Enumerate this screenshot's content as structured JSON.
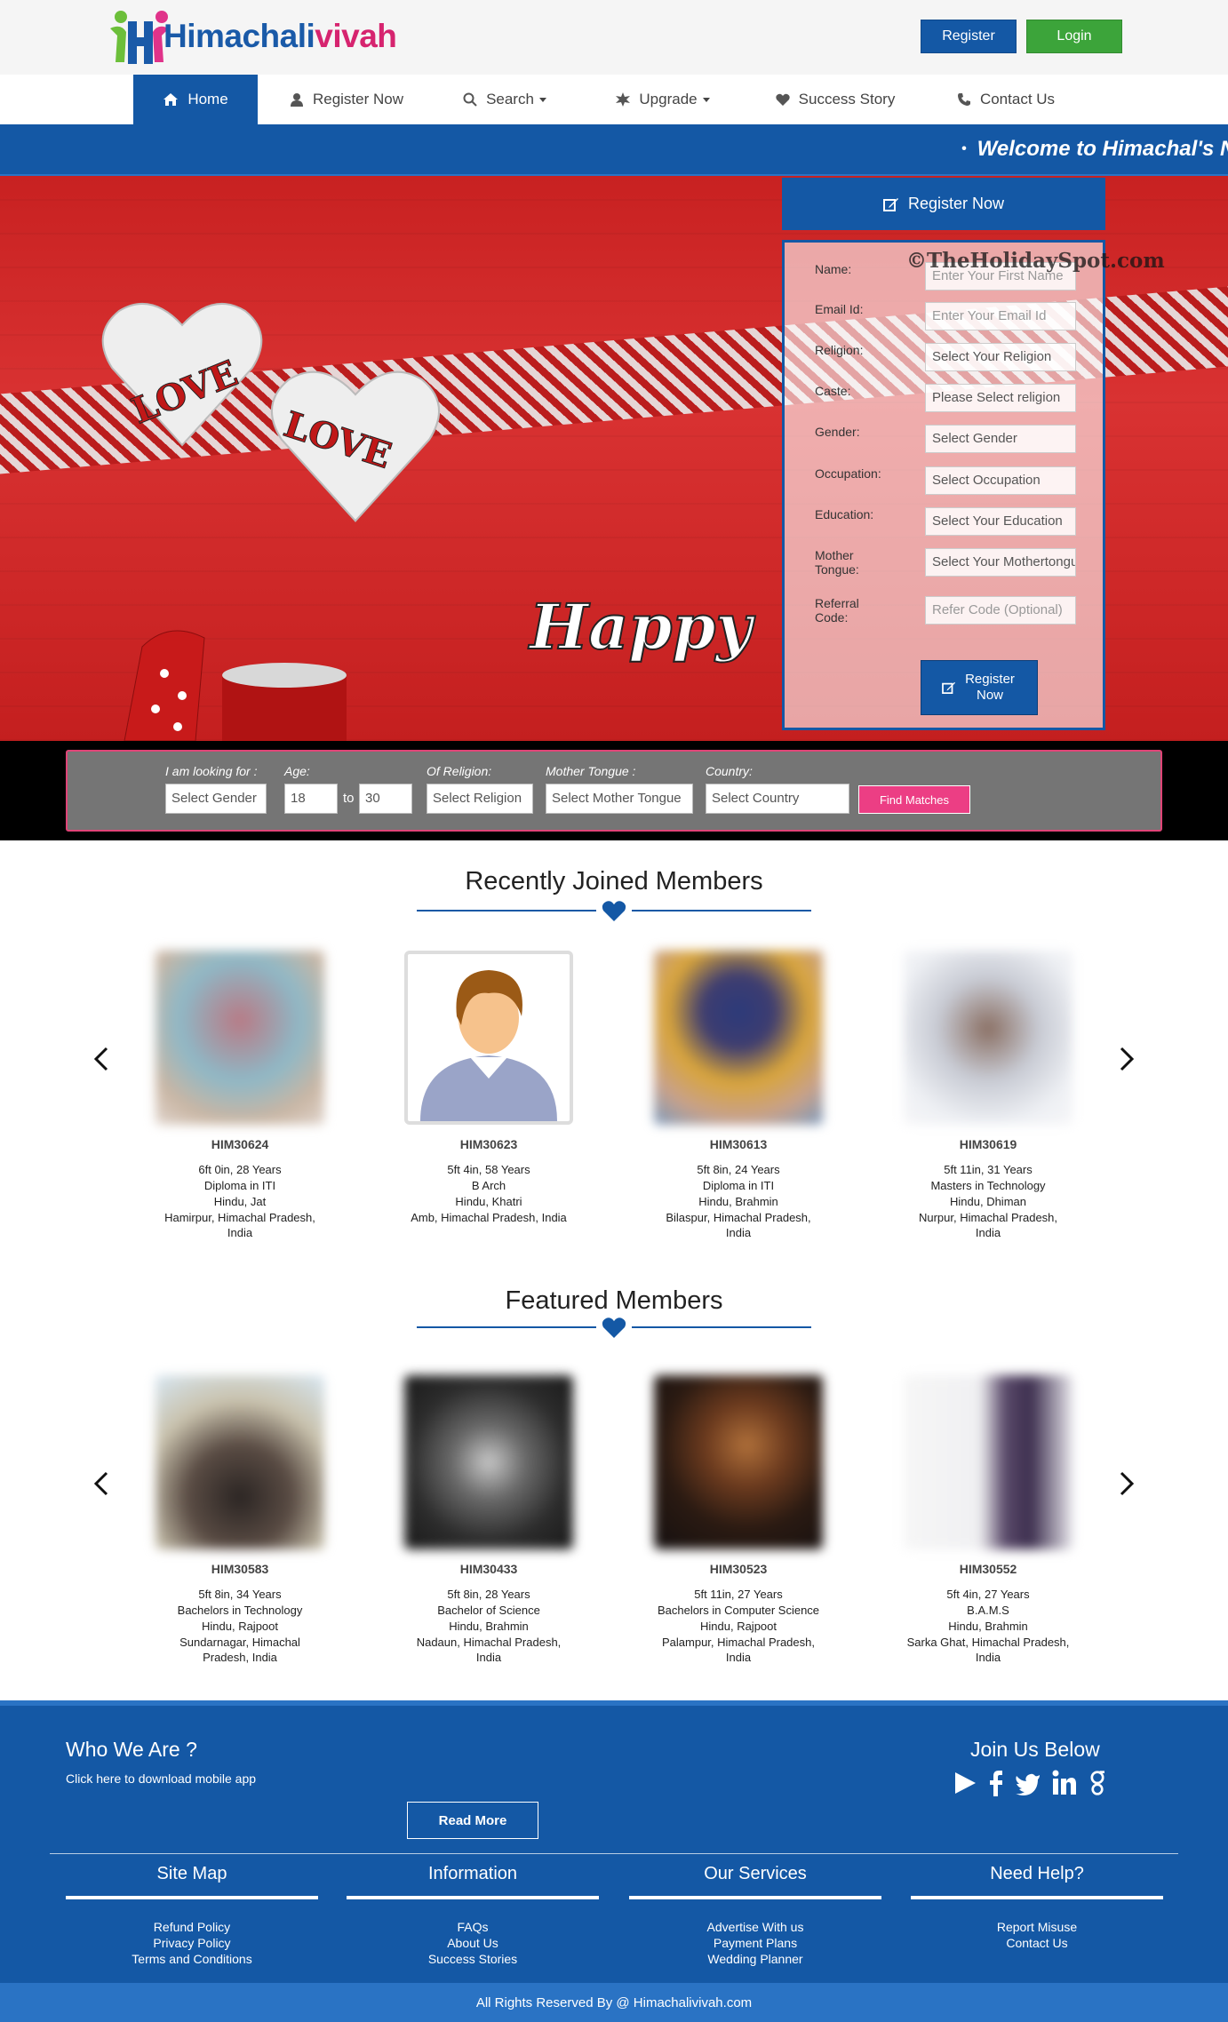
{
  "brand": {
    "part1": "Himachali",
    "part2": "vivah",
    "logo_letter": "H"
  },
  "header": {
    "register_label": "Register",
    "login_label": "Login"
  },
  "nav": {
    "items": [
      {
        "label": "Home",
        "icon": "home-icon"
      },
      {
        "label": "Register Now",
        "icon": "user-icon"
      },
      {
        "label": "Search",
        "icon": "search-icon"
      },
      {
        "label": "Upgrade",
        "icon": "badge-icon"
      },
      {
        "label": "Success Story",
        "icon": "heart-icon"
      },
      {
        "label": "Contact Us",
        "icon": "phone-icon"
      }
    ]
  },
  "marquee": {
    "text": "Welcome to Himachal's N"
  },
  "hero": {
    "heart1": "LOVE",
    "heart2": "LOVE",
    "script": "Happy",
    "watermark": "©TheHolidaySpot.com"
  },
  "register_form": {
    "title": "Register Now",
    "fields": [
      {
        "label": "Name:",
        "value": "Enter Your First Name",
        "placeholder": true
      },
      {
        "label": "Email Id:",
        "value": "Enter Your Email Id",
        "placeholder": true
      },
      {
        "label": "Religion:",
        "value": "Select Your Religion",
        "placeholder": false
      },
      {
        "label": "Caste:",
        "value": "Please Select religion",
        "placeholder": false
      },
      {
        "label": "Gender:",
        "value": "Select Gender",
        "placeholder": false
      },
      {
        "label": "Occupation:",
        "value": "Select Occupation",
        "placeholder": false
      },
      {
        "label": "Education:",
        "value": "Select Your Education",
        "placeholder": false
      },
      {
        "label": "Mother Tongue:",
        "value": "Select Your Mothertongue",
        "placeholder": false
      },
      {
        "label": "Referral Code:",
        "value": "Refer Code (Optional)",
        "placeholder": true
      }
    ],
    "submit_label": "Register Now"
  },
  "quick_search": {
    "looking_label": "I am looking for :",
    "gender_value": "Select Gender",
    "age_label": "Age:",
    "age_from": "18",
    "age_to_label": "to",
    "age_to": "30",
    "religion_label": "Of Religion:",
    "religion_value": "Select Religion",
    "tongue_label": "Mother Tongue :",
    "tongue_value": "Select Mother Tongue",
    "country_label": "Country:",
    "country_value": "Select Country",
    "find_label": "Find Matches"
  },
  "recent": {
    "title": "Recently Joined Members",
    "members": [
      {
        "id": "HIM30624",
        "l1": "6ft 0in, 28 Years",
        "l2": "Diploma in ITI",
        "l3": "Hindu, Jat",
        "l4": "Hamirpur, Himachal Pradesh,",
        "l5": "India",
        "photo": "blurred"
      },
      {
        "id": "HIM30623",
        "l1": "5ft 4in, 58 Years",
        "l2": "B Arch",
        "l3": "Hindu, Khatri",
        "l4": "Amb, Himachal Pradesh, India",
        "l5": "",
        "photo": "avatar"
      },
      {
        "id": "HIM30613",
        "l1": "5ft 8in, 24 Years",
        "l2": "Diploma in ITI",
        "l3": "Hindu, Brahmin",
        "l4": "Bilaspur, Himachal Pradesh,",
        "l5": "India",
        "photo": "blurred"
      },
      {
        "id": "HIM30619",
        "l1": "5ft 11in, 31 Years",
        "l2": "Masters in Technology",
        "l3": "Hindu, Dhiman",
        "l4": "Nurpur, Himachal Pradesh,",
        "l5": "India",
        "photo": "blurred"
      }
    ]
  },
  "featured": {
    "title": "Featured Members",
    "members": [
      {
        "id": "HIM30583",
        "l1": "5ft 8in, 34 Years",
        "l2": "Bachelors in Technology",
        "l3": "Hindu, Rajpoot",
        "l4": "Sundarnagar, Himachal",
        "l5": "Pradesh, India"
      },
      {
        "id": "HIM30433",
        "l1": "5ft 8in, 28 Years",
        "l2": "Bachelor of Science",
        "l3": "Hindu, Brahmin",
        "l4": "Nadaun, Himachal Pradesh,",
        "l5": "India"
      },
      {
        "id": "HIM30523",
        "l1": "5ft 11in, 27 Years",
        "l2": "Bachelors in Computer Science",
        "l3": "Hindu, Rajpoot",
        "l4": "Palampur, Himachal Pradesh,",
        "l5": "India"
      },
      {
        "id": "HIM30552",
        "l1": "5ft 4in, 27 Years",
        "l2": "B.A.M.S",
        "l3": "Hindu, Brahmin",
        "l4": "Sarka Ghat, Himachal Pradesh,",
        "l5": "India"
      }
    ]
  },
  "footer": {
    "who_title": "Who We Are ?",
    "who_sub": "Click here to download mobile app",
    "read_more": "Read More",
    "join_title": "Join Us Below",
    "social": [
      "play-icon",
      "facebook-icon",
      "twitter-icon",
      "linkedin-icon",
      "google-icon"
    ],
    "columns": [
      {
        "title": "Site Map",
        "links": [
          "Refund Policy",
          "Privacy Policy",
          "Terms and Conditions"
        ]
      },
      {
        "title": "Information",
        "links": [
          "FAQs",
          "About Us",
          "Success Stories"
        ]
      },
      {
        "title": "Our Services",
        "links": [
          "Advertise With us",
          "Payment Plans",
          "Wedding Planner"
        ]
      },
      {
        "title": "Need Help?",
        "links": [
          "Report Misuse",
          "Contact Us"
        ]
      }
    ],
    "copyright": "All Rights Reserved By @ Himachalivivah.com"
  },
  "colors": {
    "primary": "#1458a5",
    "accent_pink": "#ec3e84",
    "login_green": "#3ca43a"
  }
}
